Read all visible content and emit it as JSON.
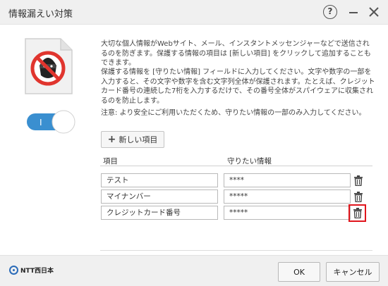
{
  "window": {
    "title": "情報漏えい対策",
    "help_glyph": "?"
  },
  "toggle": {
    "state": "on",
    "label": "I"
  },
  "description": {
    "paragraph1": "大切な個人情報がWebサイト、メール、インスタントメッセンジャーなどで送信されるのを防ぎます。保護する情報の項目は [新しい項目] をクリックして追加することもできます。",
    "paragraph2": "保護する情報を [守りたい情報] フィールドに入力してください。文字や数字の一部を入力すると、その文字や数字を含む文字列全体が保護されます。たとえば、クレジットカード番号の連続した7桁を入力するだけで、その番号全体がスパイウェアに収集されるのを防止します。",
    "paragraph3": "注意: より安全にご利用いただくため、守りたい情報の一部のみ入力してください。"
  },
  "add_button": {
    "icon": "plus-icon",
    "label": "新しい項目"
  },
  "table": {
    "columns": [
      "項目",
      "守りたい情報"
    ],
    "rows": [
      {
        "item": "テスト",
        "value": "****"
      },
      {
        "item": "マイナンバー",
        "value": "*****"
      },
      {
        "item": "クレジットカード番号",
        "value": "*****"
      }
    ]
  },
  "footer": {
    "logo_text": "NTT西日本",
    "ok_label": "OK",
    "cancel_label": "キャンセル"
  },
  "colors": {
    "toggle_on": "#3a8fd0",
    "highlight": "#e0151c",
    "logo_blue": "#2a6bb8",
    "icon_red": "#e0352e"
  }
}
